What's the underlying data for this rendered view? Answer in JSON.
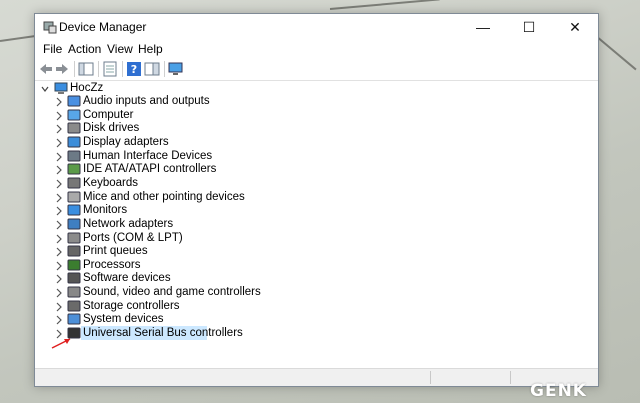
{
  "window": {
    "title": "Device Manager"
  },
  "menu": [
    "File",
    "Action",
    "View",
    "Help"
  ],
  "tree": {
    "root": "HocZz",
    "items": [
      {
        "label": "Audio inputs and outputs",
        "icon": "speaker-icon"
      },
      {
        "label": "Computer",
        "icon": "computer-icon"
      },
      {
        "label": "Disk drives",
        "icon": "disk-drive-icon"
      },
      {
        "label": "Display adapters",
        "icon": "display-adapter-icon"
      },
      {
        "label": "Human Interface Devices",
        "icon": "hid-icon"
      },
      {
        "label": "IDE ATA/ATAPI controllers",
        "icon": "ide-controller-icon"
      },
      {
        "label": "Keyboards",
        "icon": "keyboard-icon"
      },
      {
        "label": "Mice and other pointing devices",
        "icon": "mouse-icon"
      },
      {
        "label": "Monitors",
        "icon": "monitor-icon"
      },
      {
        "label": "Network adapters",
        "icon": "network-adapter-icon"
      },
      {
        "label": "Ports (COM & LPT)",
        "icon": "port-icon"
      },
      {
        "label": "Print queues",
        "icon": "printer-icon"
      },
      {
        "label": "Processors",
        "icon": "processor-icon"
      },
      {
        "label": "Software devices",
        "icon": "software-device-icon"
      },
      {
        "label": "Sound, video and game controllers",
        "icon": "sound-controller-icon"
      },
      {
        "label": "Storage controllers",
        "icon": "storage-controller-icon"
      },
      {
        "label": "System devices",
        "icon": "system-devices-icon"
      },
      {
        "label": "Universal Serial Bus controllers",
        "icon": "usb-icon"
      }
    ],
    "selected": "Universal Serial Bus controllers"
  },
  "watermark": "GENK",
  "colors": {
    "selection": "#cce8ff",
    "annotation_arrow": "#e02020"
  }
}
